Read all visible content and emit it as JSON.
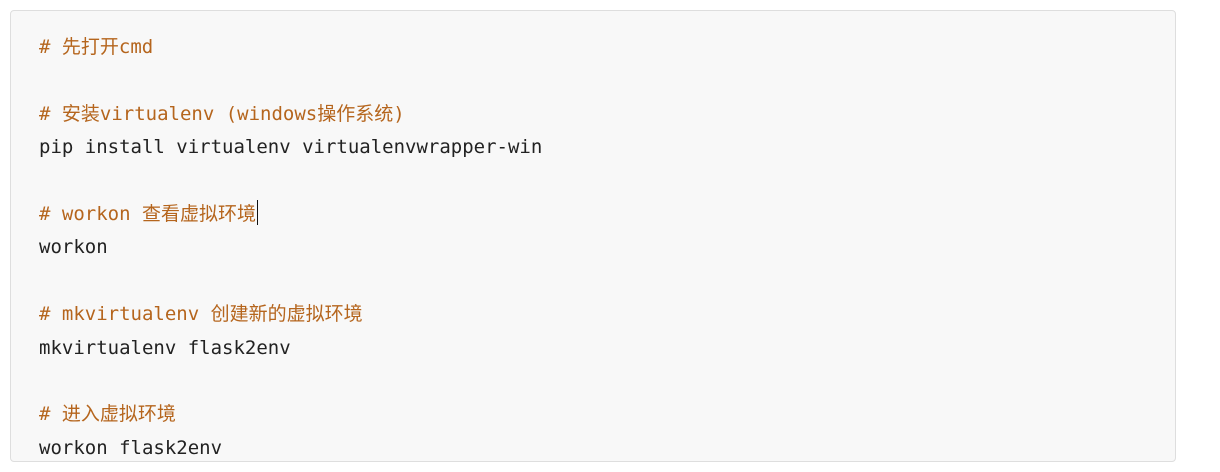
{
  "code_block": {
    "lines": [
      {
        "kind": "comment",
        "text": "# 先打开cmd"
      },
      {
        "kind": "blank",
        "text": ""
      },
      {
        "kind": "comment",
        "text": "# 安装virtualenv (windows操作系统)"
      },
      {
        "kind": "code",
        "text": "pip install virtualenv virtualenvwrapper-win"
      },
      {
        "kind": "blank",
        "text": ""
      },
      {
        "kind": "comment",
        "text": "# workon 查看虚拟环境"
      },
      {
        "kind": "code",
        "text": "workon"
      },
      {
        "kind": "blank",
        "text": ""
      },
      {
        "kind": "comment",
        "text": "# mkvirtualenv 创建新的虚拟环境"
      },
      {
        "kind": "code",
        "text": "mkvirtualenv flask2env"
      },
      {
        "kind": "blank",
        "text": ""
      },
      {
        "kind": "comment",
        "text": "# 进入虚拟环境"
      },
      {
        "kind": "code",
        "text": "workon flask2env"
      }
    ]
  },
  "colors": {
    "comment": "#b5651d",
    "code": "#222222",
    "background": "#f8f8f8",
    "border": "#dedede"
  }
}
